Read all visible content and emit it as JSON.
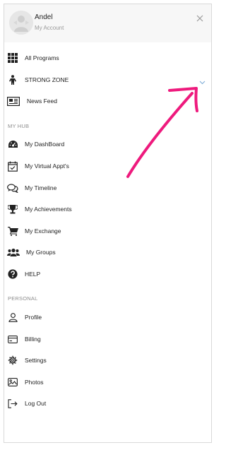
{
  "account": {
    "name": "Andel",
    "subtitle": "My Account"
  },
  "menu": {
    "programs": [
      {
        "label": "All Programs",
        "icon": "grid-icon"
      },
      {
        "label": "STRONG ZONE",
        "icon": "person-icon"
      },
      {
        "label": "News Feed",
        "icon": "newspaper-icon"
      }
    ],
    "hub_title": "MY HUB",
    "hub": [
      {
        "label": "My DashBoard",
        "icon": "dashboard-icon"
      },
      {
        "label": "My Virtual Appt's",
        "icon": "calendar-check-icon"
      },
      {
        "label": "My Timeline",
        "icon": "chat-bubbles-icon"
      },
      {
        "label": "My Achievements",
        "icon": "trophy-icon"
      },
      {
        "label": "My Exchange",
        "icon": "cart-icon"
      },
      {
        "label": "My Groups",
        "icon": "users-icon"
      },
      {
        "label": "HELP",
        "icon": "help-icon"
      }
    ],
    "personal_title": "PERSONAL",
    "personal": [
      {
        "label": "Profile",
        "icon": "user-outline-icon"
      },
      {
        "label": "Billing",
        "icon": "credit-card-icon"
      },
      {
        "label": "Settings",
        "icon": "gear-icon"
      },
      {
        "label": "Photos",
        "icon": "photo-icon"
      },
      {
        "label": "Log Out",
        "icon": "logout-icon"
      }
    ]
  },
  "colors": {
    "annotation_arrow": "#ee1a7d",
    "accent_chevron": "#7aa9d6"
  }
}
